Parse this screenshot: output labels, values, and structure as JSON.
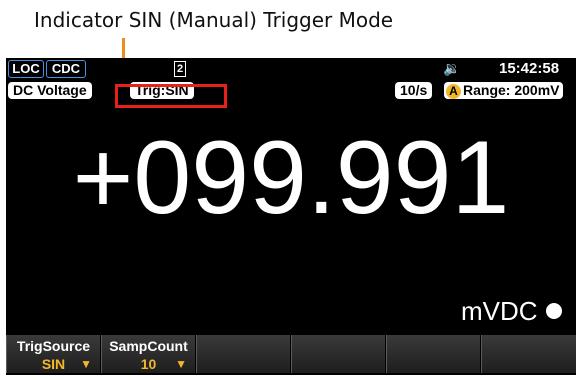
{
  "callout": "Indicator SIN (Manual) Trigger Mode",
  "status": {
    "loc": "LOC",
    "coupling": "CDC",
    "memory": "2",
    "speaker_icon": "speaker-icon",
    "time": "15:42:58"
  },
  "info": {
    "function": "DC Voltage",
    "trigger": "Trig:SIN",
    "rate": "10/s",
    "auto": "A",
    "range": "Range: 200mV"
  },
  "reading": {
    "value": "+099.991",
    "unit": "mVDC"
  },
  "softkeys": [
    {
      "label": "TrigSource",
      "value": "SIN"
    },
    {
      "label": "SampCount",
      "value": "10"
    },
    {
      "label": "",
      "value": ""
    },
    {
      "label": "",
      "value": ""
    },
    {
      "label": "",
      "value": ""
    },
    {
      "label": "",
      "value": ""
    }
  ],
  "colors": {
    "highlight": "#e8211b",
    "leader": "#f08a1c",
    "accent": "#f3b82a",
    "pill_border": "#4a90e2"
  }
}
